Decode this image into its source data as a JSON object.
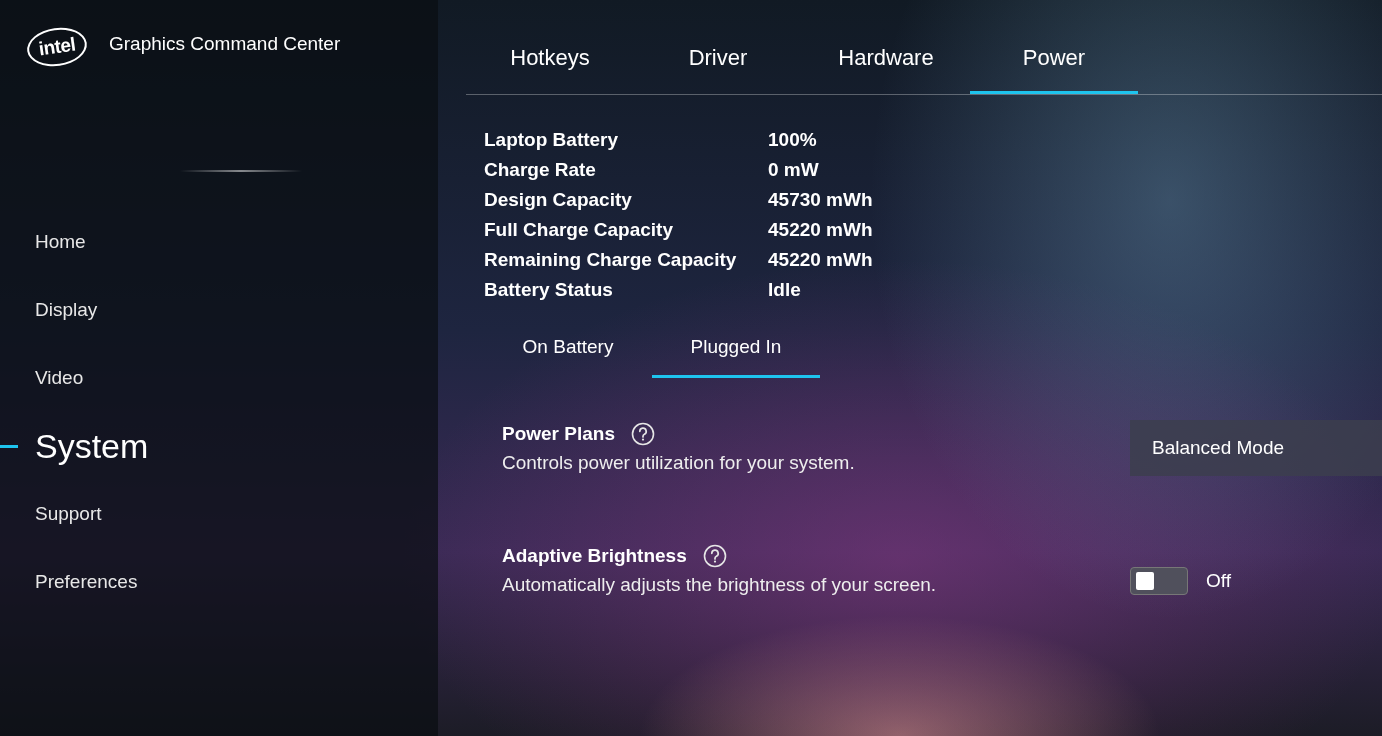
{
  "app": {
    "logo_text": "intel",
    "title": "Graphics Command Center"
  },
  "sidebar": {
    "items": [
      {
        "label": "Home",
        "selected": false
      },
      {
        "label": "Display",
        "selected": false
      },
      {
        "label": "Video",
        "selected": false
      },
      {
        "label": "System",
        "selected": true
      },
      {
        "label": "Support",
        "selected": false
      },
      {
        "label": "Preferences",
        "selected": false
      }
    ]
  },
  "tabs": [
    {
      "label": "Hotkeys",
      "selected": false
    },
    {
      "label": "Driver",
      "selected": false
    },
    {
      "label": "Hardware",
      "selected": false
    },
    {
      "label": "Power",
      "selected": true
    }
  ],
  "battery_info": [
    {
      "label": "Laptop Battery",
      "value": "100%"
    },
    {
      "label": "Charge Rate",
      "value": "0 mW"
    },
    {
      "label": "Design Capacity",
      "value": "45730 mWh"
    },
    {
      "label": "Full Charge Capacity",
      "value": "45220 mWh"
    },
    {
      "label": "Remaining Charge Capacity",
      "value": "45220 mWh"
    },
    {
      "label": "Battery Status",
      "value": "Idle"
    }
  ],
  "subtabs": [
    {
      "label": "On Battery",
      "selected": false
    },
    {
      "label": "Plugged In",
      "selected": true
    }
  ],
  "settings": [
    {
      "kind": "dropdown",
      "title": "Power Plans",
      "description": "Controls power utilization for your system.",
      "value": "Balanced Mode"
    },
    {
      "kind": "toggle",
      "title": "Adaptive Brightness",
      "description": "Automatically adjusts the brightness of your screen.",
      "on": false,
      "state_label": "Off"
    }
  ]
}
